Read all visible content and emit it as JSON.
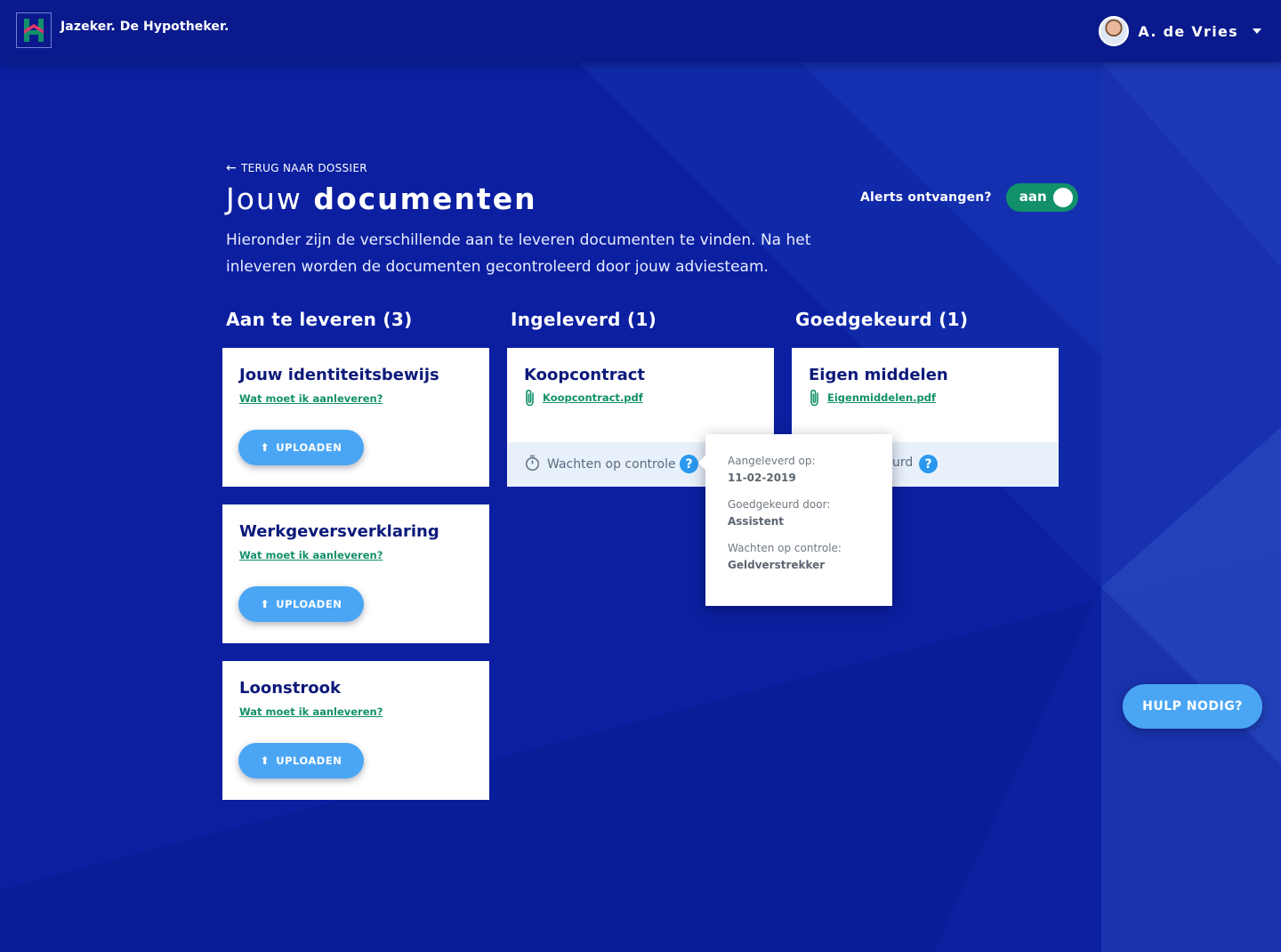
{
  "header": {
    "brand": "Jazeker. De Hypotheker.",
    "user_name": "A. de Vries"
  },
  "page": {
    "back_label": "TERUG NAAR DOSSIER",
    "title_light": "Jouw",
    "title_bold": "documenten",
    "intro": "Hieronder zijn de verschillende aan te leveren documenten te vinden. Na het inleveren worden de documenten gecontroleerd door jouw adviesteam.",
    "alerts_label": "Alerts ontvangen?",
    "alerts_toggle": "aan"
  },
  "columns": [
    {
      "title": "Aan te leveren (3)"
    },
    {
      "title": "Ingeleverd (1)"
    },
    {
      "title": "Goedgekeurd (1)"
    }
  ],
  "to_deliver": [
    {
      "title": "Jouw identiteitsbewijs",
      "link": "Wat moet ik aanleveren?",
      "button": "UPLOADEN"
    },
    {
      "title": "Werkgeversverklaring",
      "link": "Wat moet ik aanleveren?",
      "button": "UPLOADEN"
    },
    {
      "title": "Loonstrook",
      "link": "Wat moet ik aanleveren?",
      "button": "UPLOADEN"
    }
  ],
  "delivered": [
    {
      "title": "Koopcontract",
      "file": "Koopcontract.pdf",
      "status": "Wachten op controle"
    }
  ],
  "approved": [
    {
      "title": "Eigen middelen",
      "file": "Eigenmiddelen.pdf",
      "status_partial": "urd"
    }
  ],
  "tooltip": {
    "delivered_label": "Aangeleverd op:",
    "delivered_value": "11-02-2019",
    "approved_label": "Goedgekeurd door:",
    "approved_value": "Assistent",
    "waiting_label": "Wachten op controle:",
    "waiting_value": "Geldverstrekker"
  },
  "help_button": "HULP NODIG?",
  "colors": {
    "background": "#0b1fa0",
    "header": "#0a1a8c",
    "accent_green": "#12906a",
    "accent_blue": "#4aa6f5"
  }
}
